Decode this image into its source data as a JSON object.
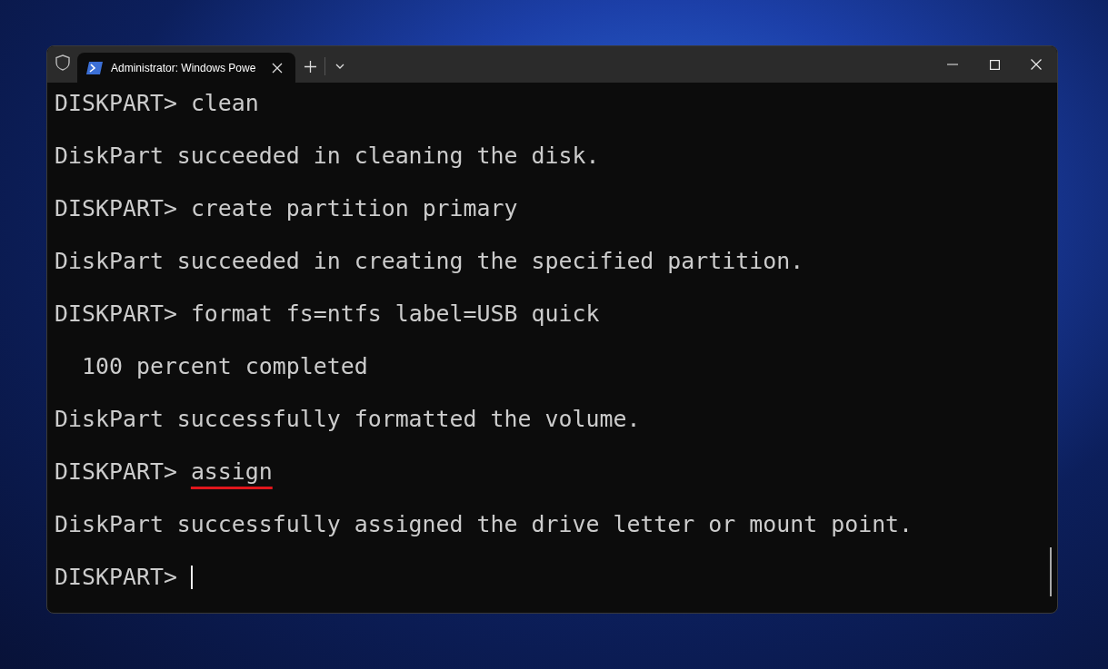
{
  "window": {
    "tab_title": "Administrator: Windows Powe"
  },
  "terminal": {
    "lines": [
      {
        "kind": "prompt",
        "prompt": "DISKPART>",
        "command": "clean",
        "underlined": false,
        "cursor": false
      },
      {
        "kind": "output",
        "text": "DiskPart succeeded in cleaning the disk."
      },
      {
        "kind": "prompt",
        "prompt": "DISKPART>",
        "command": "create partition primary",
        "underlined": false,
        "cursor": false
      },
      {
        "kind": "output",
        "text": "DiskPart succeeded in creating the specified partition."
      },
      {
        "kind": "prompt",
        "prompt": "DISKPART>",
        "command": "format fs=ntfs label=USB quick",
        "underlined": false,
        "cursor": false
      },
      {
        "kind": "output",
        "text": "  100 percent completed"
      },
      {
        "kind": "output",
        "text": "DiskPart successfully formatted the volume."
      },
      {
        "kind": "prompt",
        "prompt": "DISKPART>",
        "command": "assign",
        "underlined": true,
        "cursor": false
      },
      {
        "kind": "output",
        "text": "DiskPart successfully assigned the drive letter or mount point."
      },
      {
        "kind": "prompt",
        "prompt": "DISKPART>",
        "underlined": false,
        "cursor": true
      }
    ]
  }
}
